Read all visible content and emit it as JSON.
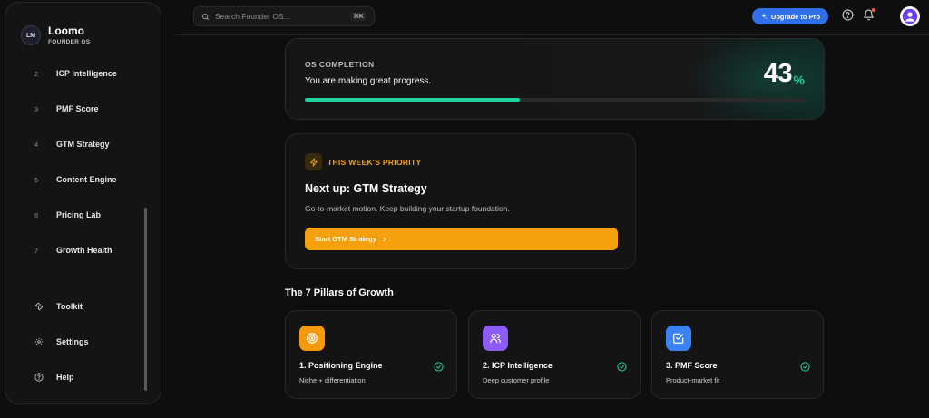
{
  "app": {
    "name": "Loomo",
    "subtitle": "FOUNDER OS",
    "logo_text": "LM"
  },
  "sidebar": {
    "nav": [
      {
        "num": "2",
        "label": "ICP Intelligence"
      },
      {
        "num": "3",
        "label": "PMF Score"
      },
      {
        "num": "4",
        "label": "GTM Strategy"
      },
      {
        "num": "5",
        "label": "Content Engine"
      },
      {
        "num": "6",
        "label": "Pricing Lab"
      },
      {
        "num": "7",
        "label": "Growth Health"
      }
    ],
    "footer": [
      {
        "icon": "wrench-icon",
        "label": "Toolkit"
      },
      {
        "icon": "gear-icon",
        "label": "Settings"
      },
      {
        "icon": "help-icon",
        "label": "Help"
      }
    ]
  },
  "topbar": {
    "search_placeholder": "Search Founder OS...",
    "shortcut": "⌘K",
    "upgrade_label": "Upgrade to Pro"
  },
  "completion": {
    "eyebrow": "OS COMPLETION",
    "message": "You are making great progress.",
    "percent": "43",
    "percent_sign": "%",
    "progress": 0.43,
    "accent": "#1fd4a0"
  },
  "priority": {
    "eyebrow": "THIS WEEK'S PRIORITY",
    "title": "Next up: GTM Strategy",
    "description": "Go-to-market motion. Keep building your startup foundation.",
    "button_label": "Start GTM Strategy",
    "accent": "#f5a00f"
  },
  "pillars": {
    "title": "The 7 Pillars of Growth",
    "items": [
      {
        "title": "1. Positioning Engine",
        "subtitle": "Niche + differentiation",
        "icon": "target-icon",
        "color": "#f59a0c"
      },
      {
        "title": "2. ICP Intelligence",
        "subtitle": "Deep customer profile",
        "icon": "users-icon",
        "color": "#8b5cf6"
      },
      {
        "title": "3. PMF Score",
        "subtitle": "Product-market fit",
        "icon": "check-square-icon",
        "color": "#3b82f6"
      }
    ]
  }
}
